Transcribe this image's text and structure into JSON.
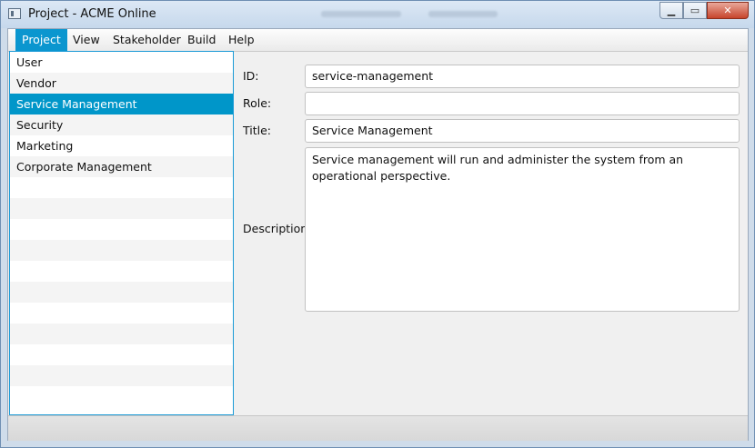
{
  "window": {
    "title": "Project - ACME Online"
  },
  "menubar": {
    "items": [
      "Project",
      "View",
      "Stakeholder",
      "Build",
      "Help"
    ],
    "active": "Project"
  },
  "list": {
    "items": [
      "User",
      "Vendor",
      "Service Management",
      "Security",
      "Marketing",
      "Corporate Management"
    ],
    "selected": "Service Management"
  },
  "form": {
    "id_label": "ID:",
    "id_value": "service-management",
    "role_label": "Role:",
    "role_value": "",
    "title_label": "Title:",
    "title_value": "Service Management",
    "description_label": "Description:",
    "description_value": "Service management will run and administer the system from an operational perspective."
  },
  "colors": {
    "accent": "#0096c9",
    "window_frame": "#c6d8ec",
    "close_button": "#c7442b"
  },
  "icons": {
    "app": "window-icon",
    "minimize": "minimize-icon",
    "maximize": "maximize-icon",
    "close": "close-icon"
  }
}
